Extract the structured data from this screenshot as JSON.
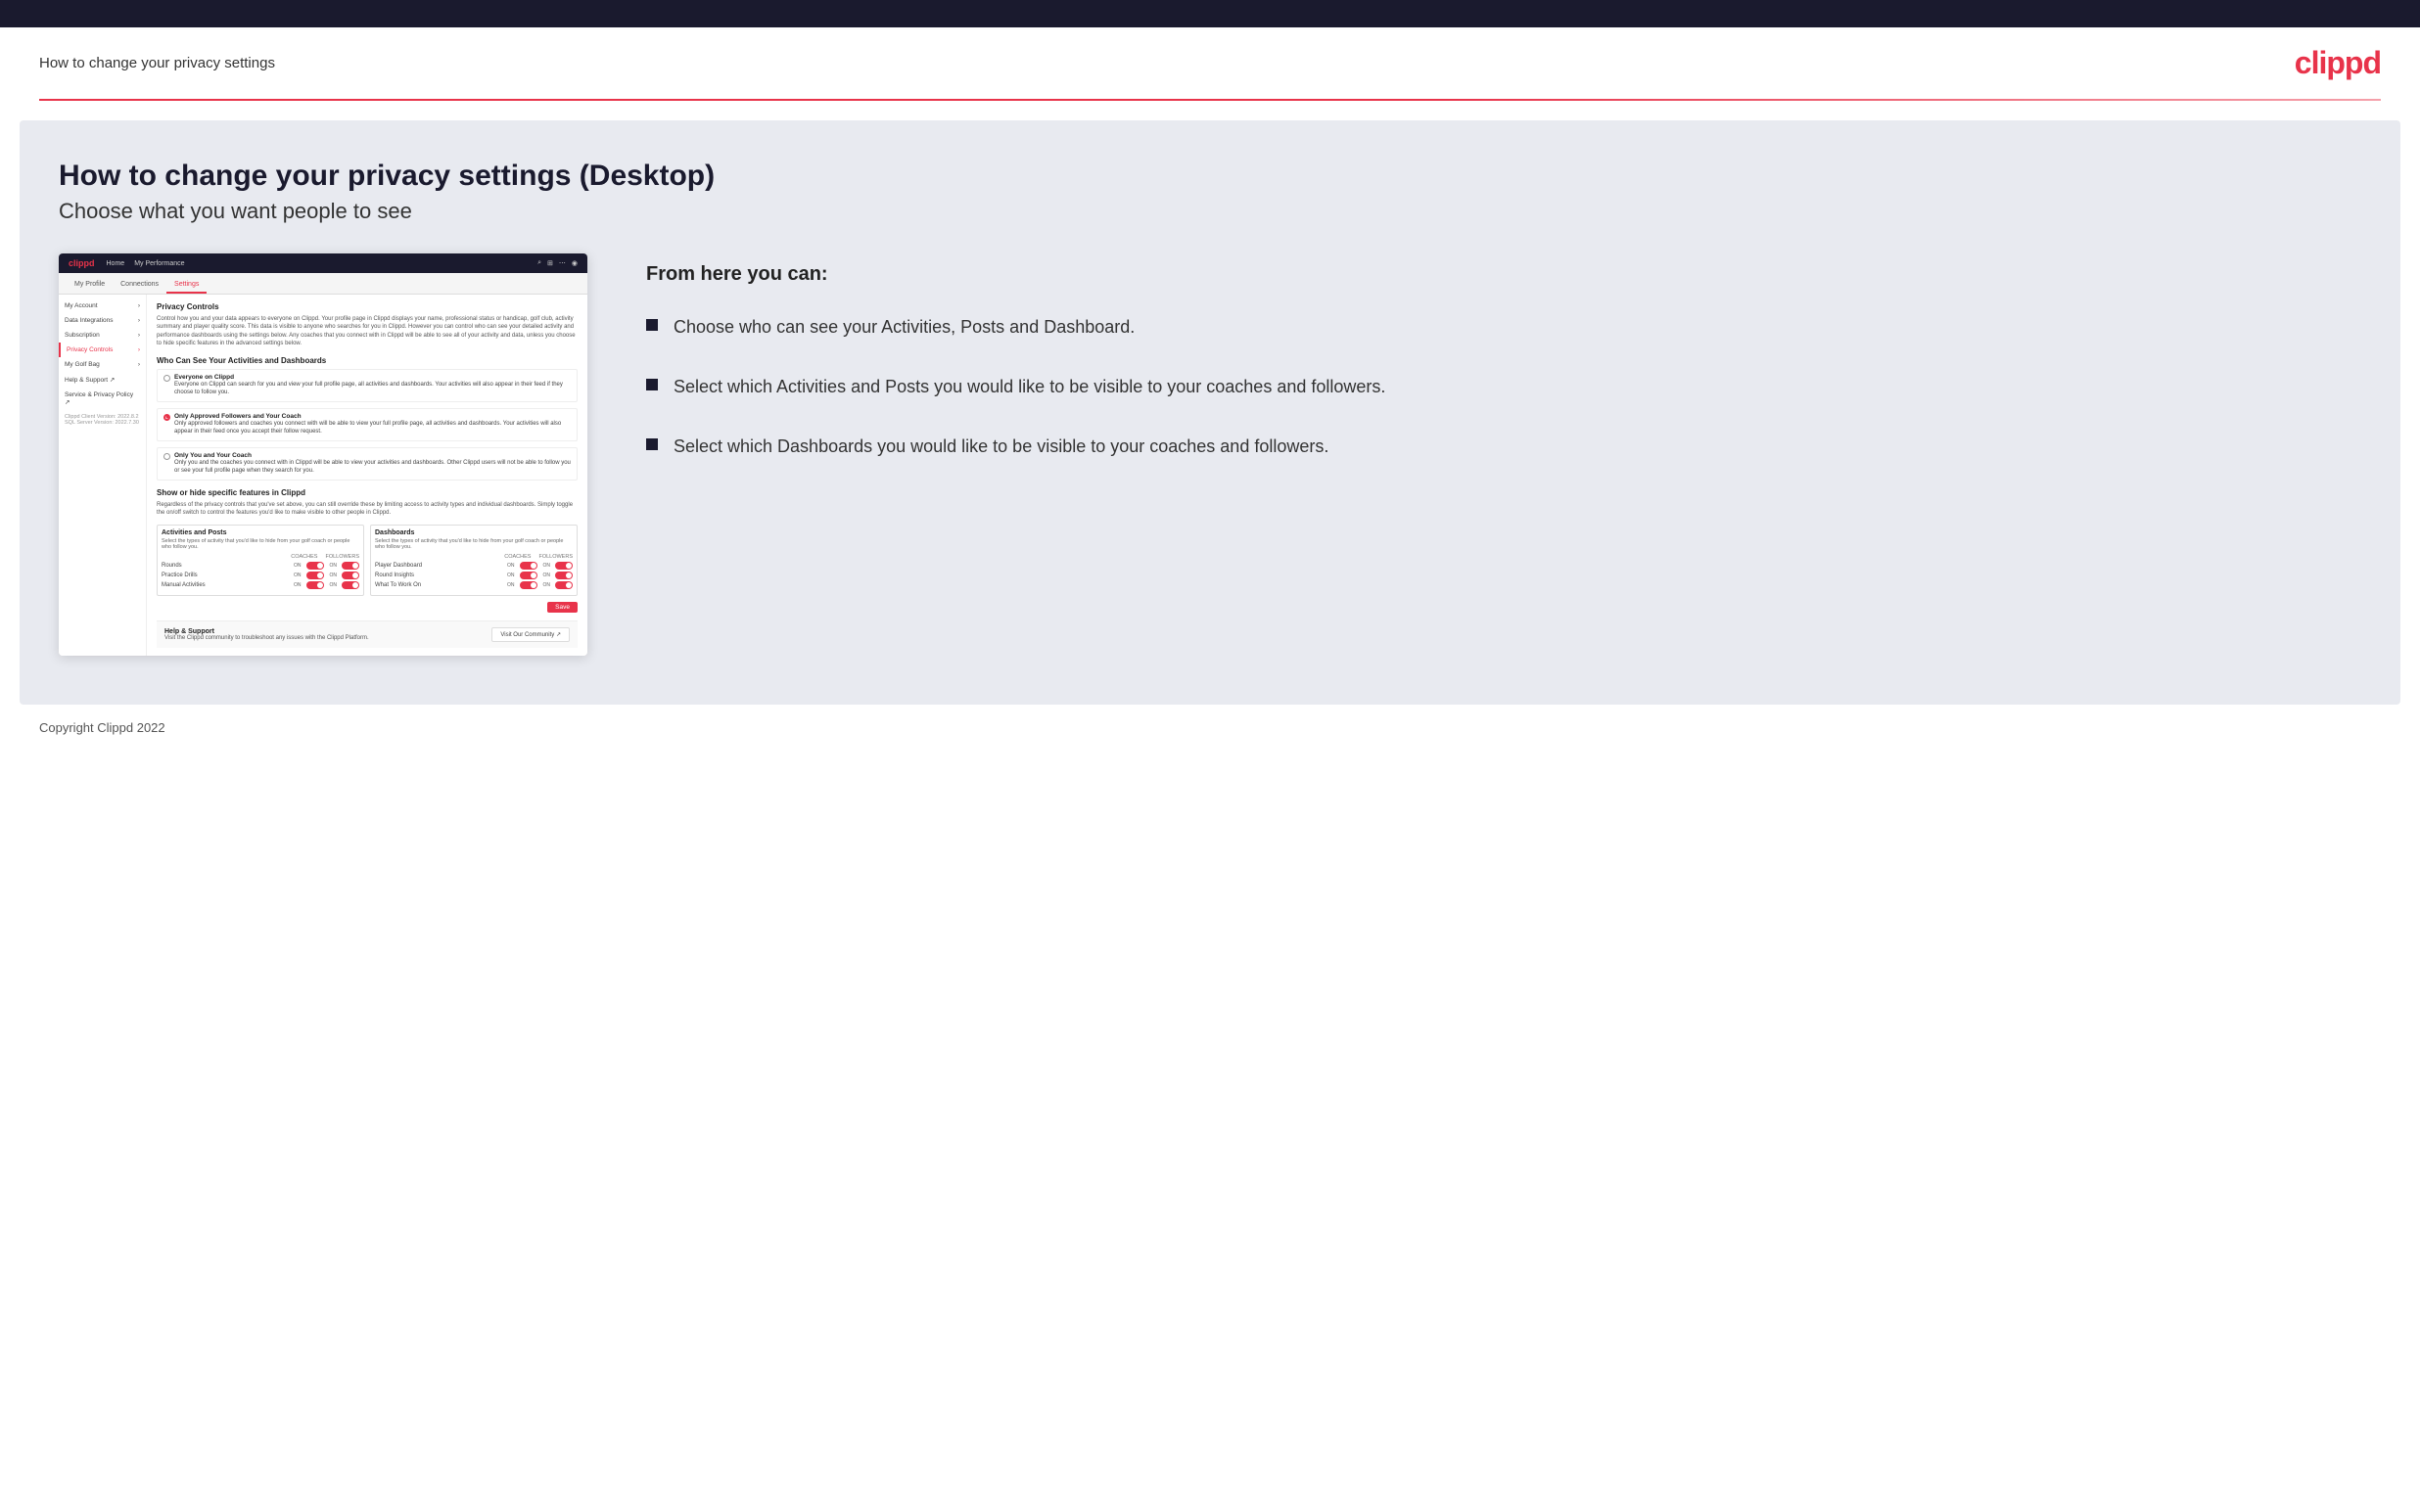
{
  "header": {
    "title": "How to change your privacy settings",
    "logo": "clippd"
  },
  "page": {
    "heading": "How to change your privacy settings (Desktop)",
    "subheading": "Choose what you want people to see"
  },
  "from_here": {
    "label": "From here you can:",
    "bullets": [
      "Choose who can see your Activities, Posts and Dashboard.",
      "Select which Activities and Posts you would like to be visible to your coaches and followers.",
      "Select which Dashboards you would like to be visible to your coaches and followers."
    ]
  },
  "mock": {
    "nav": {
      "logo": "clippd",
      "links": [
        "Home",
        "My Performance"
      ]
    },
    "tabs": [
      "My Profile",
      "Connections",
      "Settings"
    ],
    "sidebar": [
      {
        "label": "My Account",
        "active": false
      },
      {
        "label": "Data Integrations",
        "active": false
      },
      {
        "label": "Subscription",
        "active": false
      },
      {
        "label": "Privacy Controls",
        "active": true
      },
      {
        "label": "My Golf Bag",
        "active": false
      },
      {
        "label": "Help & Support ↗",
        "active": false
      },
      {
        "label": "Service & Privacy Policy ↗",
        "active": false
      }
    ],
    "privacy_controls": {
      "title": "Privacy Controls",
      "desc": "Control how you and your data appears to everyone on Clippd. Your profile page in Clippd displays your name, professional status or handicap, golf club, activity summary and player quality score. This data is visible to anyone who searches for you in Clippd. However you can control who can see your detailed activity and performance dashboards using the settings below. Any coaches that you connect with in Clippd will be able to see all of your activity and data, unless you choose to hide specific features in the advanced settings below.",
      "who_can_see_title": "Who Can See Your Activities and Dashboards",
      "radio_options": [
        {
          "id": "everyone",
          "title": "Everyone on Clippd",
          "desc": "Everyone on Clippd can search for you and view your full profile page, all activities and dashboards. Your activities will also appear in their feed if they choose to follow you.",
          "selected": false
        },
        {
          "id": "followers",
          "title": "Only Approved Followers and Your Coach",
          "desc": "Only approved followers and coaches you connect with will be able to view your full profile page, all activities and dashboards. Your activities will also appear in their feed once you accept their follow request.",
          "selected": true
        },
        {
          "id": "coach_only",
          "title": "Only You and Your Coach",
          "desc": "Only you and the coaches you connect with in Clippd will be able to view your activities and dashboards. Other Clippd users will not be able to follow you or see your full profile page when they search for you.",
          "selected": false
        }
      ],
      "show_hide_title": "Show or hide specific features in Clippd",
      "show_hide_desc": "Regardless of the privacy controls that you've set above, you can still override these by limiting access to activity types and individual dashboards. Simply toggle the on/off switch to control the features you'd like to make visible to other people in Clippd.",
      "activities_panel": {
        "title": "Activities and Posts",
        "desc": "Select the types of activity that you'd like to hide from your golf coach or people who follow you.",
        "rows": [
          {
            "label": "Rounds",
            "coaches_on": true,
            "followers_on": true
          },
          {
            "label": "Practice Drills",
            "coaches_on": true,
            "followers_on": true
          },
          {
            "label": "Manual Activities",
            "coaches_on": true,
            "followers_on": true
          }
        ]
      },
      "dashboards_panel": {
        "title": "Dashboards",
        "desc": "Select the types of activity that you'd like to hide from your golf coach or people who follow you.",
        "rows": [
          {
            "label": "Player Dashboard",
            "coaches_on": true,
            "followers_on": true
          },
          {
            "label": "Round Insights",
            "coaches_on": true,
            "followers_on": true
          },
          {
            "label": "What To Work On",
            "coaches_on": true,
            "followers_on": true
          }
        ]
      }
    },
    "help": {
      "title": "Help & Support",
      "desc": "Visit the Clippd community to troubleshoot any issues with the Clippd Platform.",
      "button": "Visit Our Community"
    },
    "version": "Clippd Client Version: 2022.8.2\nSQL Server Version: 2022.7.30"
  },
  "footer": {
    "copyright": "Copyright Clippd 2022"
  }
}
